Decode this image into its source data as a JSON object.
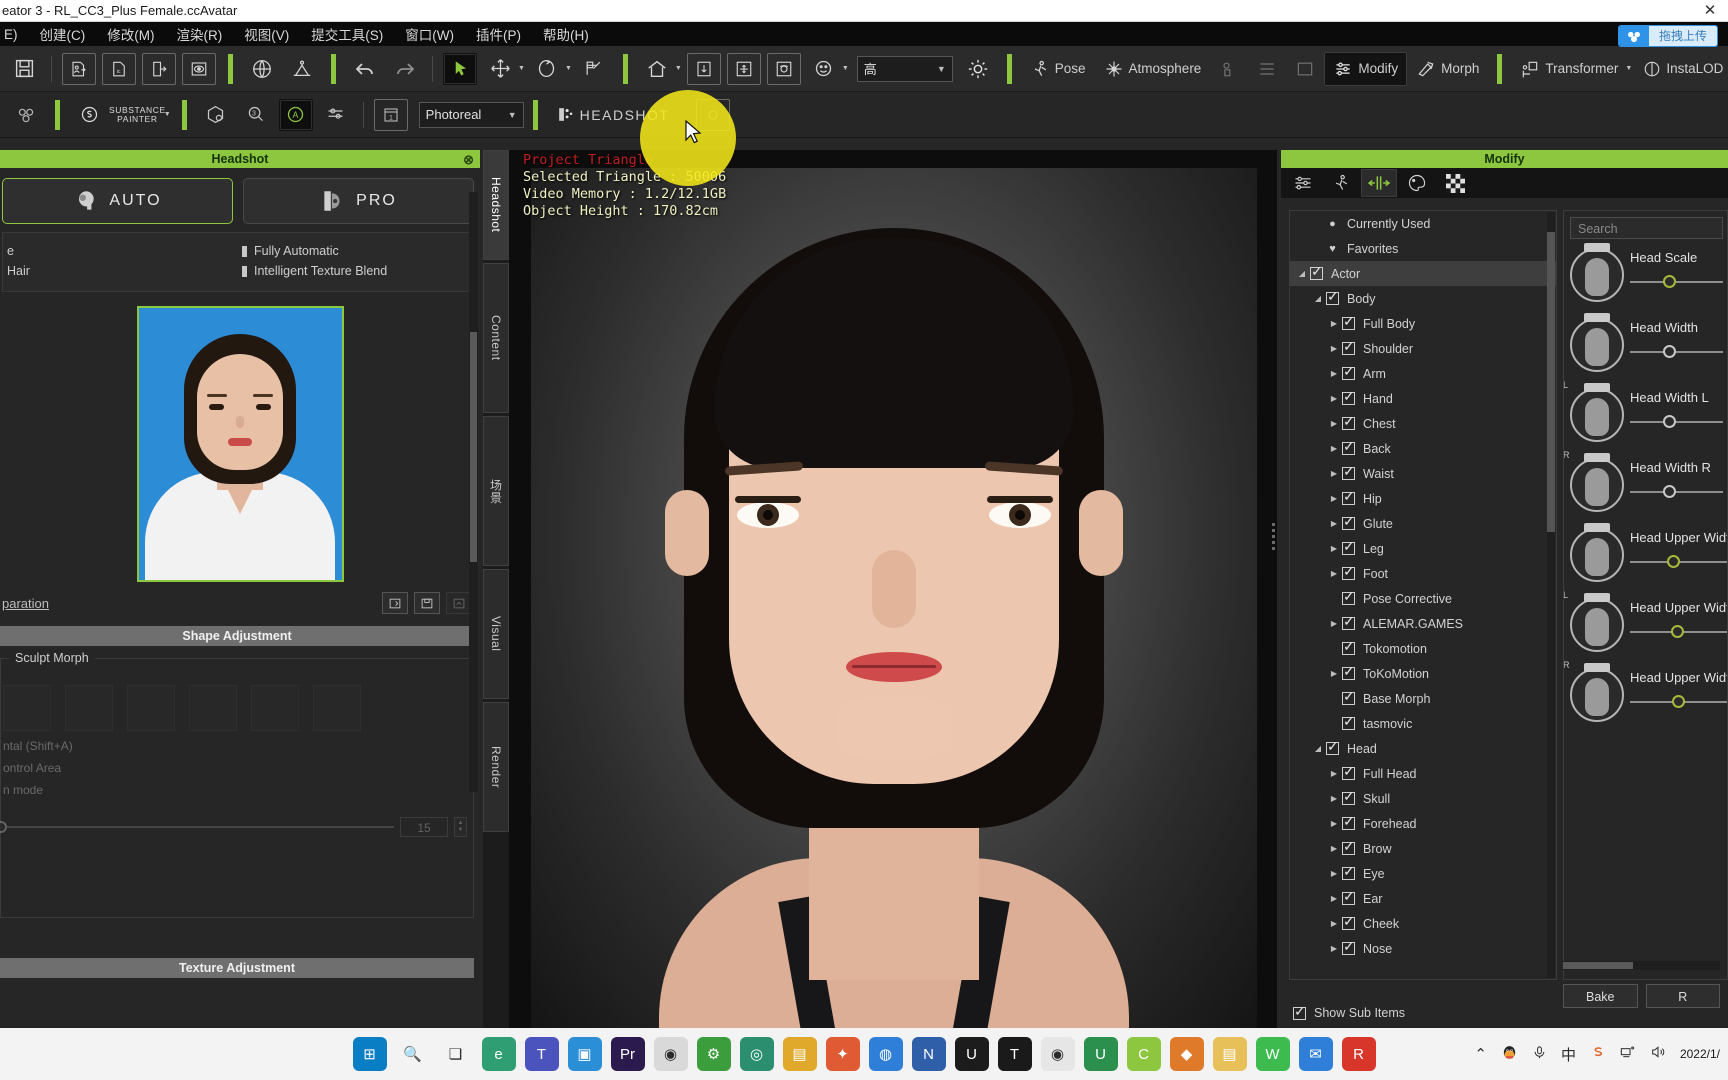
{
  "window": {
    "title": "eator 3 - RL_CC3_Plus Female.ccAvatar",
    "close_glyph": "✕"
  },
  "menubar": {
    "items": [
      "E)",
      "创建(C)",
      "修改(M)",
      "渲染(R)",
      "视图(V)",
      "提交工具(S)",
      "窗口(W)",
      "插件(P)",
      "帮助(H)"
    ]
  },
  "netdisk": {
    "icon": "baidu-netdisk-icon",
    "label": "拖拽上传"
  },
  "toolbar1": {
    "quality_value": "高",
    "quality_caret": "▼",
    "tools": [
      {
        "name": "pose-tool",
        "label": "Pose"
      },
      {
        "name": "atmosphere-tool",
        "label": "Atmosphere"
      },
      {
        "name": "modify-tool",
        "label": "Modify"
      },
      {
        "name": "morph-tool",
        "label": "Morph"
      },
      {
        "name": "transformer-tool",
        "label": "Transformer"
      },
      {
        "name": "instalod-tool",
        "label": "InstaLOD"
      }
    ]
  },
  "toolbar2": {
    "substance_line1": "SUBSTANCE",
    "substance_line2": "PAINTER",
    "render_mode": "Photoreal",
    "render_caret": "▼",
    "headshot_label": "HEADSHOT",
    "frame_value": "1"
  },
  "left_panel": {
    "title": "Headshot",
    "close_glyph": "⊗",
    "modes": [
      {
        "name": "auto-mode-button",
        "label": "AUTO",
        "selected": true
      },
      {
        "name": "pro-mode-button",
        "label": "PRO",
        "selected": false
      }
    ],
    "options_left": [
      "e",
      "Hair"
    ],
    "options_right": [
      "Fully Automatic",
      "Intelligent Texture Blend"
    ],
    "prep_link": "paration",
    "shape_adjustment_header": "Shape Adjustment",
    "sculpt_morph_legend": "Sculpt Morph",
    "dim_lines": [
      "ntal (Shift+A)",
      "ontrol Area",
      "n mode"
    ],
    "slider_value": "15",
    "texture_adjustment_header": "Texture Adjustment"
  },
  "vtabs": {
    "items": [
      {
        "name": "vtab-headshot",
        "label": "Headshot",
        "selected": true
      },
      {
        "name": "vtab-content",
        "label": "Content",
        "selected": false
      },
      {
        "name": "vtab-scene",
        "label": "场景",
        "selected": false
      },
      {
        "name": "vtab-visual",
        "label": "Visual",
        "selected": false
      },
      {
        "name": "vtab-render",
        "label": "Render",
        "selected": false
      }
    ]
  },
  "viewport": {
    "hud": [
      {
        "text": "Project Triangle",
        "style": "red"
      },
      {
        "text": "Selected Triangle : 50006",
        "style": "yellow"
      },
      {
        "text": "Video Memory : 1.2/12.1GB",
        "style": "yellow"
      },
      {
        "text": "Object Height : 170.82cm",
        "style": "yellow"
      }
    ]
  },
  "right_panel": {
    "title": "Modify",
    "tabs": [
      {
        "name": "tab-attribute",
        "icon": "sliders-icon",
        "selected": false
      },
      {
        "name": "tab-pose",
        "icon": "pose-icon",
        "selected": false
      },
      {
        "name": "tab-morph",
        "icon": "morph-arrows-icon",
        "selected": true
      },
      {
        "name": "tab-material",
        "icon": "palette-icon",
        "selected": false
      },
      {
        "name": "tab-texture",
        "icon": "checker-icon",
        "selected": false
      }
    ],
    "tree": [
      {
        "label": "Currently Used",
        "indent": 1,
        "marker": "dot",
        "twisty": "",
        "selected": false
      },
      {
        "label": "Favorites",
        "indent": 1,
        "marker": "heart",
        "twisty": "",
        "selected": false
      },
      {
        "label": "Actor",
        "indent": 0,
        "marker": "check",
        "twisty": "down",
        "selected": true
      },
      {
        "label": "Body",
        "indent": 1,
        "marker": "check",
        "twisty": "down",
        "selected": false
      },
      {
        "label": "Full Body",
        "indent": 2,
        "marker": "check",
        "twisty": "right",
        "selected": false
      },
      {
        "label": "Shoulder",
        "indent": 2,
        "marker": "check",
        "twisty": "right",
        "selected": false
      },
      {
        "label": "Arm",
        "indent": 2,
        "marker": "check",
        "twisty": "right",
        "selected": false
      },
      {
        "label": "Hand",
        "indent": 2,
        "marker": "check",
        "twisty": "right",
        "selected": false
      },
      {
        "label": "Chest",
        "indent": 2,
        "marker": "check",
        "twisty": "right",
        "selected": false
      },
      {
        "label": "Back",
        "indent": 2,
        "marker": "check",
        "twisty": "right",
        "selected": false
      },
      {
        "label": "Waist",
        "indent": 2,
        "marker": "check",
        "twisty": "right",
        "selected": false
      },
      {
        "label": "Hip",
        "indent": 2,
        "marker": "check",
        "twisty": "right",
        "selected": false
      },
      {
        "label": "Glute",
        "indent": 2,
        "marker": "check",
        "twisty": "right",
        "selected": false
      },
      {
        "label": "Leg",
        "indent": 2,
        "marker": "check",
        "twisty": "right",
        "selected": false
      },
      {
        "label": "Foot",
        "indent": 2,
        "marker": "check",
        "twisty": "right",
        "selected": false
      },
      {
        "label": "Pose Corrective",
        "indent": 2,
        "marker": "check",
        "twisty": "",
        "selected": false
      },
      {
        "label": "ALEMAR.GAMES",
        "indent": 2,
        "marker": "check",
        "twisty": "right",
        "selected": false
      },
      {
        "label": "Tokomotion",
        "indent": 2,
        "marker": "check",
        "twisty": "",
        "selected": false
      },
      {
        "label": "ToKoMotion",
        "indent": 2,
        "marker": "check",
        "twisty": "right",
        "selected": false
      },
      {
        "label": "Base Morph",
        "indent": 2,
        "marker": "check",
        "twisty": "",
        "selected": false
      },
      {
        "label": "tasmovic",
        "indent": 2,
        "marker": "check",
        "twisty": "",
        "selected": false
      },
      {
        "label": "Head",
        "indent": 1,
        "marker": "check",
        "twisty": "down",
        "selected": false
      },
      {
        "label": "Full Head",
        "indent": 2,
        "marker": "check",
        "twisty": "right",
        "selected": false
      },
      {
        "label": "Skull",
        "indent": 2,
        "marker": "check",
        "twisty": "right",
        "selected": false
      },
      {
        "label": "Forehead",
        "indent": 2,
        "marker": "check",
        "twisty": "right",
        "selected": false
      },
      {
        "label": "Brow",
        "indent": 2,
        "marker": "check",
        "twisty": "right",
        "selected": false
      },
      {
        "label": "Eye",
        "indent": 2,
        "marker": "check",
        "twisty": "right",
        "selected": false
      },
      {
        "label": "Ear",
        "indent": 2,
        "marker": "check",
        "twisty": "right",
        "selected": false
      },
      {
        "label": "Cheek",
        "indent": 2,
        "marker": "check",
        "twisty": "right",
        "selected": false
      },
      {
        "label": "Nose",
        "indent": 2,
        "marker": "check",
        "twisty": "right",
        "selected": false
      }
    ],
    "search_placeholder": "Search",
    "sliders": [
      {
        "name": "Head Scale",
        "side": "",
        "knob": 36,
        "accent": true
      },
      {
        "name": "Head Width",
        "side": "",
        "knob": 36,
        "accent": false
      },
      {
        "name": "Head Width L",
        "side": "L",
        "knob": 36,
        "accent": false
      },
      {
        "name": "Head Width R",
        "side": "R",
        "knob": 36,
        "accent": false
      },
      {
        "name": "Head Upper Width",
        "side": "",
        "knob": 36,
        "accent": true
      },
      {
        "name": "Head Upper Width L",
        "side": "L",
        "knob": 36,
        "accent": true
      },
      {
        "name": "Head Upper Width R",
        "side": "R",
        "knob": 36,
        "accent": true
      }
    ],
    "buttons": [
      {
        "name": "bake-button",
        "label": "Bake"
      },
      {
        "name": "reset-button",
        "label": "R"
      }
    ],
    "show_sub_items": "Show Sub Items"
  },
  "taskbar": {
    "items": [
      {
        "name": "start-button",
        "icon": "windows-icon",
        "color": "#0a7ec4"
      },
      {
        "name": "search-button",
        "icon": "search-icon",
        "color": "#f3f3f3"
      },
      {
        "name": "task-view-button",
        "icon": "taskview-icon",
        "color": "#f3f3f3"
      },
      {
        "name": "edge-app",
        "icon": "edge-icon",
        "color": "#2f9e73"
      },
      {
        "name": "teams-app",
        "icon": "teams-icon",
        "color": "#4b53bc"
      },
      {
        "name": "store-app",
        "icon": "store-icon",
        "color": "#2b8fd8"
      },
      {
        "name": "premiere-app",
        "icon": "premiere-icon",
        "color": "#2b1a4d"
      },
      {
        "name": "chrome-app",
        "icon": "chrome-icon",
        "color": "#d9d9d9"
      },
      {
        "name": "settings-app",
        "icon": "settings-icon",
        "color": "#3c9d3c"
      },
      {
        "name": "recorder-app",
        "icon": "recorder-icon",
        "color": "#2b8f6f"
      },
      {
        "name": "folder-app",
        "icon": "folder-icon",
        "color": "#e0a92b"
      },
      {
        "name": "design-app",
        "icon": "design-icon",
        "color": "#e05a34"
      },
      {
        "name": "globe-app",
        "icon": "globe-icon",
        "color": "#2f7fd8"
      },
      {
        "name": "nvidia-app",
        "icon": "nvidia-icon",
        "color": "#2f5fa8"
      },
      {
        "name": "ue-app",
        "icon": "unreal-icon",
        "color": "#1c1c1c"
      },
      {
        "name": "tencent-app",
        "icon": "tencent-icon",
        "color": "#1a1a1a"
      },
      {
        "name": "chrome2-app",
        "icon": "chrome-icon",
        "color": "#e6e6e6"
      },
      {
        "name": "utorrent-app",
        "icon": "utorrent-icon",
        "color": "#2b8f4d"
      },
      {
        "name": "cc3-app",
        "icon": "character-creator-icon",
        "color": "#8dc63f"
      },
      {
        "name": "orange-app",
        "icon": "orange-app-icon",
        "color": "#e07a2b"
      },
      {
        "name": "files-app",
        "icon": "files-icon",
        "color": "#e8c05a"
      },
      {
        "name": "wechat-app",
        "icon": "wechat-icon",
        "color": "#3dbb4f"
      },
      {
        "name": "mail-app",
        "icon": "mail-icon",
        "color": "#2f7fd8"
      },
      {
        "name": "red-app",
        "icon": "red-app-icon",
        "color": "#d8352b"
      }
    ],
    "tray": {
      "chevron": "⌃",
      "qq": "qq-icon",
      "mic": "mic-icon",
      "ime": "中",
      "sogou": "sogou-icon",
      "network": "network-icon",
      "volume": "volume-icon",
      "clock": "2022/1/"
    }
  }
}
